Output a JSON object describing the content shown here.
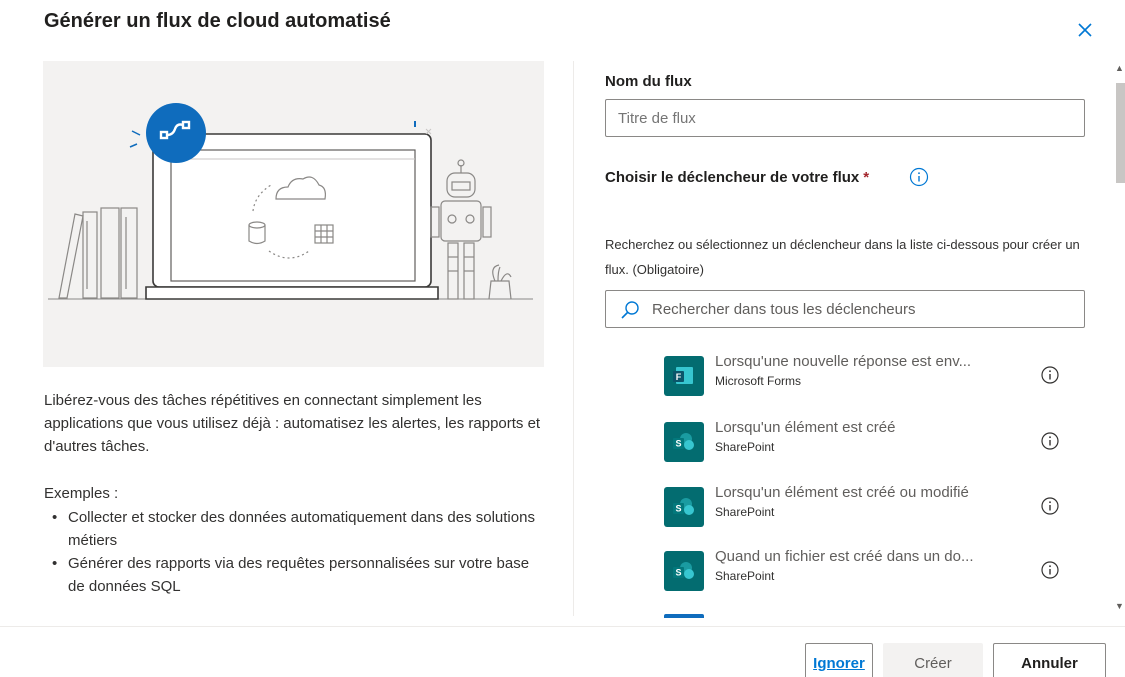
{
  "dialog": {
    "title": "Générer un flux de cloud automatisé",
    "close_icon": "close-icon"
  },
  "left": {
    "intro": "Libérez-vous des tâches répétitives en connectant simplement les applications que vous utilisez déjà : automatisez les alertes, les rapports et d'autres tâches.",
    "examples_title": "Exemples :",
    "examples": [
      "Collecter et stocker des données automatiquement dans des solutions métiers",
      "Générer des rapports via des requêtes personnalisées sur votre base de données SQL"
    ]
  },
  "right": {
    "name_label": "Nom du flux",
    "name_placeholder": "Titre de flux",
    "trigger_label": "Choisir le déclencheur de votre flux",
    "required_mark": "*",
    "helper_text": "Recherchez ou sélectionnez un déclencheur dans la liste ci-dessous pour créer un flux. (Obligatoire)",
    "search_placeholder": "Rechercher dans tous les déclencheurs",
    "triggers": [
      {
        "title": "Lorsqu'une nouvelle réponse est env...",
        "connector": "Microsoft Forms",
        "icon": "microsoft-forms-icon",
        "color": "#036c70"
      },
      {
        "title": "Lorsqu'un élément est créé",
        "connector": "SharePoint",
        "icon": "sharepoint-icon",
        "color": "#036c70"
      },
      {
        "title": "Lorsqu'un élément est créé ou modifié",
        "connector": "SharePoint",
        "icon": "sharepoint-icon",
        "color": "#036c70"
      },
      {
        "title": "Quand un fichier est créé dans un do...",
        "connector": "SharePoint",
        "icon": "sharepoint-icon",
        "color": "#036c70"
      }
    ]
  },
  "footer": {
    "ignore_label": "Ignorer",
    "create_label": "Créer",
    "cancel_label": "Annuler"
  },
  "colors": {
    "accent": "#0078d4",
    "brand_blue": "#0f6cbd",
    "required": "#a4262c"
  }
}
